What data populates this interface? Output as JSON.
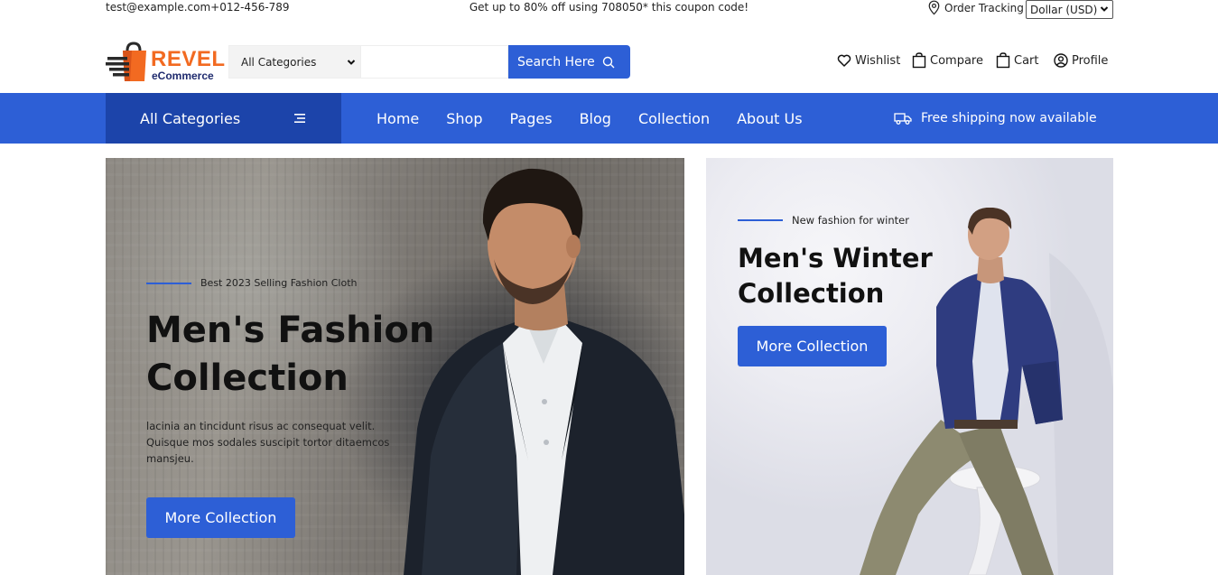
{
  "topbar": {
    "contact": "test@example.com+012-456-789",
    "promo": "Get up to 80% off using 708050* this coupon code!",
    "order_tracking": "Order Tracking",
    "currency": "Dollar (USD)"
  },
  "header": {
    "logo_word1": "REVEL",
    "logo_word2": "eCommerce",
    "category_select": "All Categories",
    "search_placeholder": "",
    "search_button": "Search Here",
    "links": {
      "wishlist": "Wishlist",
      "compare": "Compare",
      "cart": "Cart",
      "profile": "Profile"
    }
  },
  "nav": {
    "all_categories": "All Categories",
    "items": [
      "Home",
      "Shop",
      "Pages",
      "Blog",
      "Collection",
      "About Us"
    ],
    "shipping": "Free shipping now available"
  },
  "hero_left": {
    "eyebrow": "Best 2023 Selling Fashion Cloth",
    "title": "Men's Fashion Collection",
    "description": "lacinia an tincidunt risus ac consequat velit. Quisque mos sodales suscipit tortor ditaemcos mansjeu.",
    "button": "More Collection"
  },
  "hero_right": {
    "eyebrow": "New fashion for winter",
    "title": "Men's Winter Collection",
    "button": "More Collection"
  },
  "colors": {
    "accent": "#2d5fd6",
    "accent_dark": "#1c44aa",
    "logo_orange": "#f26a21",
    "logo_navy": "#1f2b6e"
  }
}
